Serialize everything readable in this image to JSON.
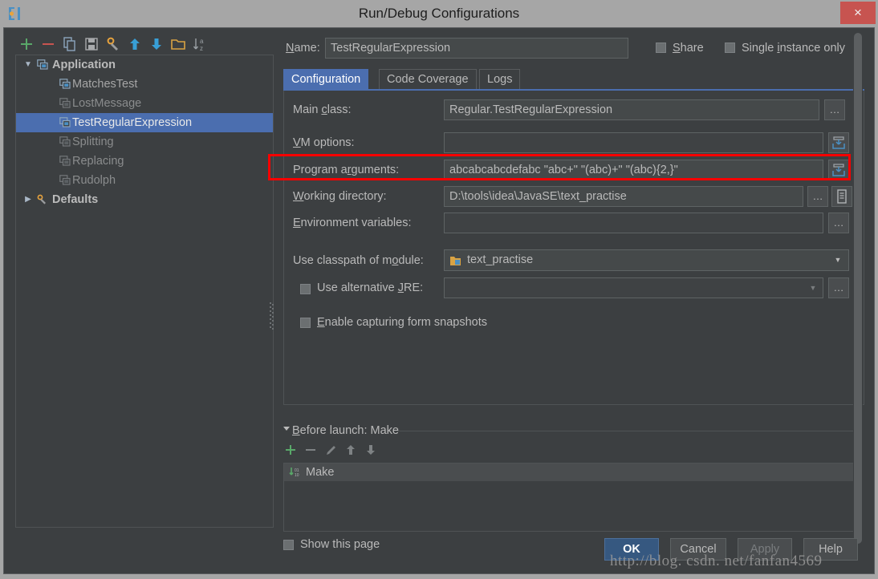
{
  "window": {
    "title": "Run/Debug Configurations",
    "app_icon": "intellij-idea-icon",
    "close_label": "×"
  },
  "tree_toolbar": {
    "items": [
      {
        "name": "add-configuration-button",
        "glyph": "+"
      },
      {
        "name": "remove-configuration-button",
        "glyph": "−"
      },
      {
        "name": "copy-configuration-button",
        "glyph": "copy-icon"
      },
      {
        "name": "save-configuration-button",
        "glyph": "save-icon"
      },
      {
        "name": "edit-templates-button",
        "glyph": "wrench-icon"
      },
      {
        "name": "move-up-button",
        "glyph": "↑"
      },
      {
        "name": "move-down-button",
        "glyph": "↓"
      },
      {
        "name": "create-folder-button",
        "glyph": "folder-icon"
      },
      {
        "name": "sort-configurations-button",
        "glyph": "sort-az-icon"
      }
    ]
  },
  "tree": {
    "nodes": [
      {
        "label": "Application",
        "level": 0,
        "expanded": true,
        "arrow": "▼",
        "selected": false,
        "dim": false
      },
      {
        "label": "MatchesTest",
        "level": 1,
        "arrow": "",
        "selected": false,
        "dim": false
      },
      {
        "label": "LostMessage",
        "level": 1,
        "arrow": "",
        "selected": false,
        "dim": true
      },
      {
        "label": "TestRegularExpression",
        "level": 1,
        "arrow": "",
        "selected": true,
        "dim": false
      },
      {
        "label": "Splitting",
        "level": 1,
        "arrow": "",
        "selected": false,
        "dim": true
      },
      {
        "label": "Replacing",
        "level": 1,
        "arrow": "",
        "selected": false,
        "dim": true
      },
      {
        "label": "Rudolph",
        "level": 1,
        "arrow": "",
        "selected": false,
        "dim": true
      },
      {
        "label": "Defaults",
        "level": 0,
        "expanded": false,
        "arrow": "▶",
        "selected": false,
        "dim": false
      }
    ]
  },
  "name_row": {
    "label": "Name:",
    "value": "TestRegularExpression",
    "share_label": "Share",
    "share_checked": false,
    "single_instance_label": "Single instance only",
    "single_instance_checked": false
  },
  "tabs": [
    {
      "label": "Configuration",
      "active": true
    },
    {
      "label": "Code Coverage",
      "active": false
    },
    {
      "label": "Logs",
      "active": false
    }
  ],
  "config": {
    "main_class_label": "Main class:",
    "main_class_value": "Regular.TestRegularExpression",
    "main_class_browse": "…",
    "vm_options_label": "VM options:",
    "vm_options_value": "",
    "vm_options_expand_icon": "expand-editor-icon",
    "program_arguments_label": "Program arguments:",
    "program_arguments_value": "abcabcabcdefabc \"abc+\" \"(abc)+\" \"(abc){2,}\"",
    "program_arguments_expand_icon": "expand-editor-icon",
    "working_directory_label": "Working directory:",
    "working_directory_value": "D:\\tools\\idea\\JavaSE\\text_practise",
    "working_directory_browse": "…",
    "working_directory_macro_icon": "insert-macro-icon",
    "environment_variables_label": "Environment variables:",
    "environment_variables_value": "",
    "environment_variables_browse": "…",
    "classpath_module_label": "Use classpath of module:",
    "classpath_module_value": "text_practise",
    "classpath_module_icon": "module-icon",
    "classpath_dropdown_arrow": "▼",
    "alt_jre_label": "Use alternative JRE:",
    "alt_jre_checked": false,
    "alt_jre_value": "",
    "alt_jre_dropdown_arrow": "▼",
    "alt_jre_browse": "…",
    "form_snapshots_label": "Enable capturing form snapshots",
    "form_snapshots_checked": false
  },
  "before_launch": {
    "title": "Before launch: Make",
    "collapse_arrow": "▼",
    "toolbar": [
      {
        "name": "add-task-button",
        "glyph": "+"
      },
      {
        "name": "remove-task-button",
        "glyph": "−"
      },
      {
        "name": "edit-task-button",
        "glyph": "pencil-icon"
      },
      {
        "name": "task-move-up-button",
        "glyph": "↑"
      },
      {
        "name": "task-move-down-button",
        "glyph": "↓"
      }
    ],
    "tasks": [
      {
        "label": "Make",
        "icon": "compile-make-icon"
      }
    ],
    "show_page_label": "Show this page",
    "show_page_checked": false
  },
  "buttons": [
    {
      "label": "OK",
      "style": "primary"
    },
    {
      "label": "Cancel",
      "style": "normal"
    },
    {
      "label": "Apply",
      "style": "disabled"
    },
    {
      "label": "Help",
      "style": "normal"
    }
  ],
  "watermark": "http://blog. csdn. net/fanfan4569",
  "colors": {
    "accent": "#4b6eaf",
    "highlight_box": "#fa0000",
    "close_button": "#c75450",
    "panel_bg": "#3c3f41",
    "field_bg": "#45494a"
  }
}
